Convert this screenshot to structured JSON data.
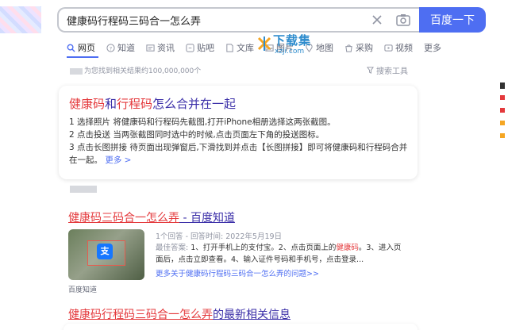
{
  "search": {
    "query": "健康码行程码三码合一怎么弄",
    "button_label": "百度一下"
  },
  "tabs": [
    {
      "label": "网页",
      "icon": "search-icon",
      "active": true
    },
    {
      "label": "知道",
      "icon": "question-icon"
    },
    {
      "label": "资讯",
      "icon": "news-icon"
    },
    {
      "label": "贴吧",
      "icon": "tieba-icon"
    },
    {
      "label": "文库",
      "icon": "library-icon"
    },
    {
      "label": "图片",
      "icon": "image-icon"
    },
    {
      "label": "地图",
      "icon": "map-icon"
    },
    {
      "label": "采购",
      "icon": "shop-icon"
    },
    {
      "label": "视频",
      "icon": "video-icon"
    },
    {
      "label": "更多",
      "icon": ""
    }
  ],
  "watermark": {
    "title": "下载集",
    "subtitle": "xzji.com"
  },
  "result_count": "为您找到相关结果约100,000,000个",
  "search_tools": "搜索工具",
  "answer_card": {
    "title_parts": [
      {
        "text": "健康码",
        "hl": true
      },
      {
        "text": "和",
        "hl": false
      },
      {
        "text": "行程码",
        "hl": true
      },
      {
        "text": "怎么合并在一起",
        "hl": false
      }
    ],
    "steps": [
      "1 选择照片 将健康码和行程码先截图,打开iPhone相册选择这两张截图。",
      "2 点击投送 当两张截图同时选中的时候,点击页面左下角的投送图标。",
      "3 点击长图拼接 待页面出现弹窗后,下滑找到并点击【长图拼接】即可将健康码和行程码合并在一起。"
    ],
    "more_label": "更多 >"
  },
  "result1": {
    "title_hl": "健康码三码合一怎么弄",
    "title_rest": " - 百度知道",
    "meta": "1个回答 - 回答时间: 2022年5月19日",
    "best_label": "最佳答案: ",
    "best_text_1": "1、打开手机上的支付宝。2、点击页面上的",
    "best_hl": "健康码",
    "best_text_2": "。3、进入页面后，点击立即查看。4、输入证件号码和手机号，点击登录...",
    "more_answers": "更多关于健康码行程码三码合一怎么弄的问题>>",
    "thumb_caption": "百度知道",
    "thumb_app_glyph": "支"
  },
  "result2": {
    "title_hl": "健康码行程码三码合一怎么弄",
    "title_rest": "的最新相关信息"
  },
  "colors": {
    "accent": "#4e6ef2",
    "highlight": "#e4393c",
    "link": "#3b2fa8"
  }
}
